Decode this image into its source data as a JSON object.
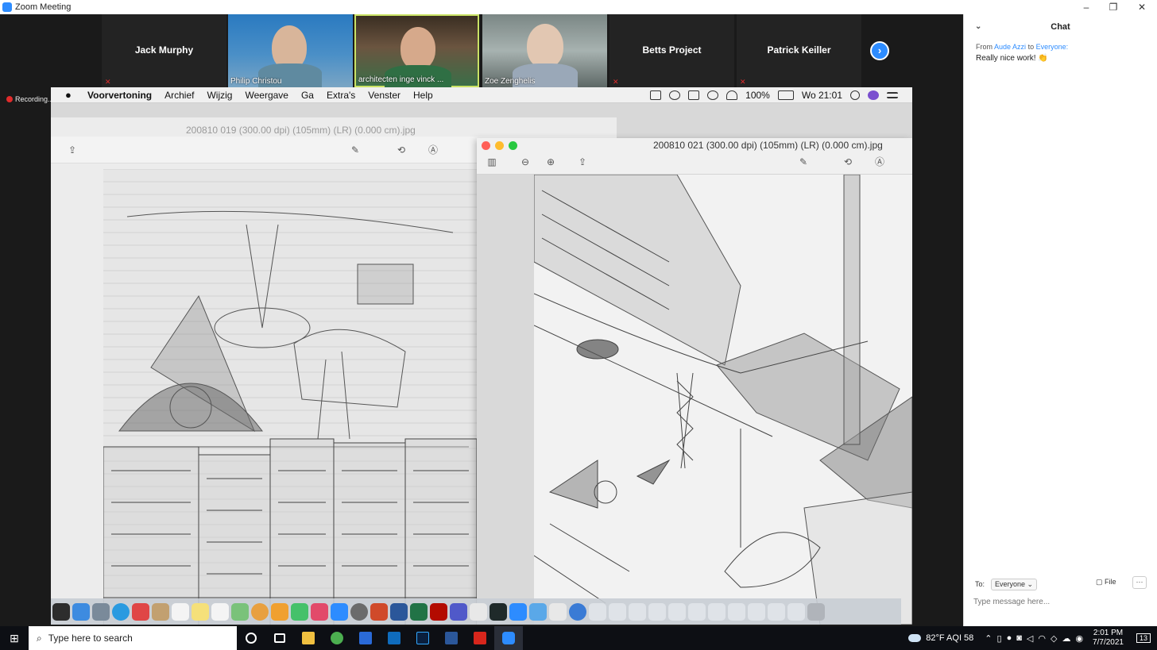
{
  "window": {
    "title": "Zoom Meeting",
    "min": "–",
    "max": "❐",
    "close": "✕"
  },
  "participants": [
    {
      "name": "Jack Murphy",
      "type": "name"
    },
    {
      "name": "Philip Christou",
      "type": "video"
    },
    {
      "name": "architecten inge vinck ...",
      "type": "video"
    },
    {
      "name": "Zoe Zenghelis",
      "type": "video"
    },
    {
      "name": "Betts Project",
      "type": "name"
    },
    {
      "name": "Patrick Keiller",
      "type": "name"
    }
  ],
  "recording_label": "Recording...",
  "mac": {
    "menu": [
      "Voorvertoning",
      "Archief",
      "Wijzig",
      "Weergave",
      "Ga",
      "Extra's",
      "Venster",
      "Help"
    ],
    "status": {
      "battery": "100%",
      "clock": "Wo 21:01"
    },
    "back_window_title": "200810 019 (300.00 dpi) (105mm) (LR) (0.000 cm).jpg",
    "front_window_title": "200810 021 (300.00 dpi) (105mm) (LR) (0.000 cm).jpg"
  },
  "chat": {
    "title": "Chat",
    "message": {
      "from_prefix": "From",
      "sender": "Aude Azzi",
      "to_word": "to",
      "recipient": "Everyone:",
      "text": "Really nice work! 👏"
    },
    "to_label": "To:",
    "to_value": "Everyone",
    "file_label": "File",
    "more_label": "···",
    "input_placeholder": "Type message here..."
  },
  "taskbar": {
    "search_placeholder": "Type here to search",
    "weather": "82°F  AQI 58",
    "time": "2:01 PM",
    "date": "7/7/2021",
    "notifications": "13"
  },
  "colors": {
    "zoom_blue": "#2d8cff",
    "mute_red": "#e02b2b",
    "taskbar": "#0d0f14"
  }
}
